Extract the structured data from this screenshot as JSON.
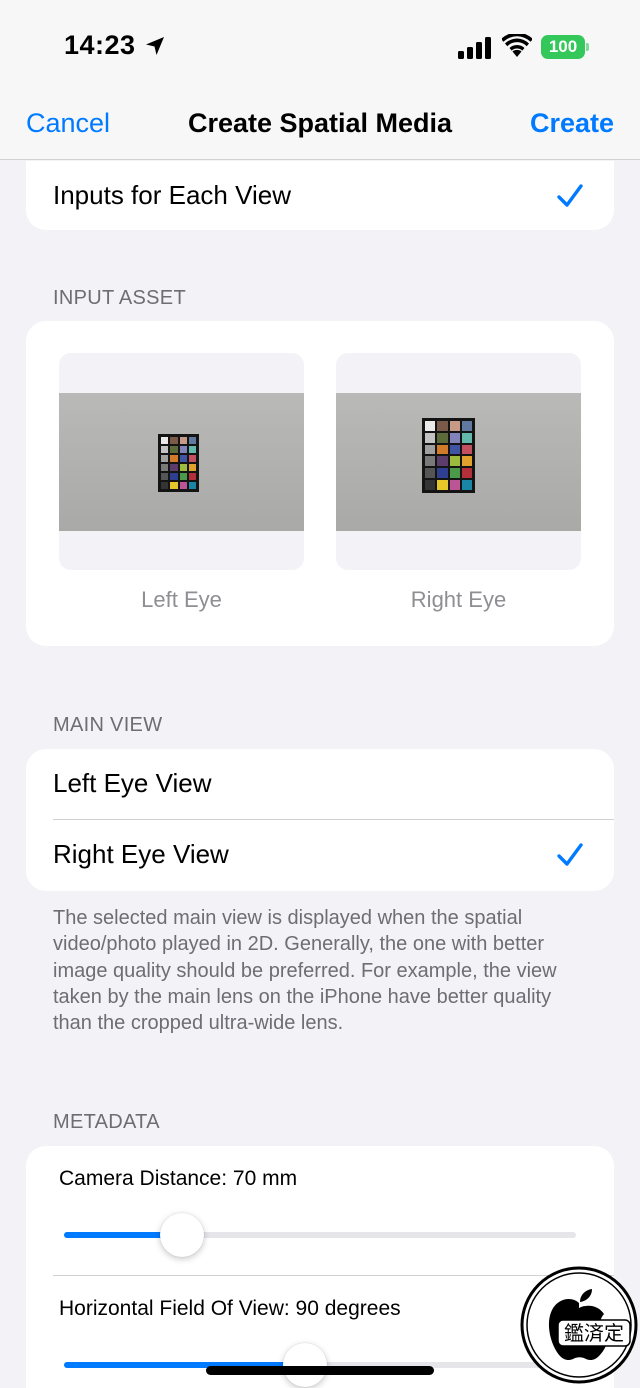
{
  "status_bar": {
    "time": "14:23",
    "battery": "100",
    "icons": [
      "location-arrow-icon",
      "cellular-signal-icon",
      "wifi-icon",
      "battery-icon"
    ]
  },
  "nav": {
    "cancel": "Cancel",
    "title": "Create Spatial Media",
    "create": "Create"
  },
  "input_mode": {
    "label": "Inputs for Each View",
    "selected": true
  },
  "input_asset": {
    "header": "INPUT ASSET",
    "left_caption": "Left Eye",
    "right_caption": "Right Eye"
  },
  "main_view": {
    "header": "MAIN VIEW",
    "options": [
      {
        "label": "Left Eye View",
        "selected": false
      },
      {
        "label": "Right Eye View",
        "selected": true
      }
    ],
    "footer": "The selected main view is displayed when the spatial video/photo played in 2D. Generally, the one with better image quality should be preferred. For example, the view taken by the main lens on the iPhone have better quality than the cropped ultra-wide lens."
  },
  "metadata": {
    "header": "METADATA",
    "sliders": [
      {
        "label": "Camera Distance: 70 mm",
        "value_fraction": 0.23
      },
      {
        "label": "Horizontal Field Of View: 90 degrees",
        "value_fraction": 0.47
      }
    ]
  },
  "watermark": {
    "text": "鑑済定"
  },
  "colors": {
    "accent": "#007aff",
    "background": "#f2f2f7",
    "battery": "#34c759",
    "secondary_text": "#6d6d72"
  }
}
